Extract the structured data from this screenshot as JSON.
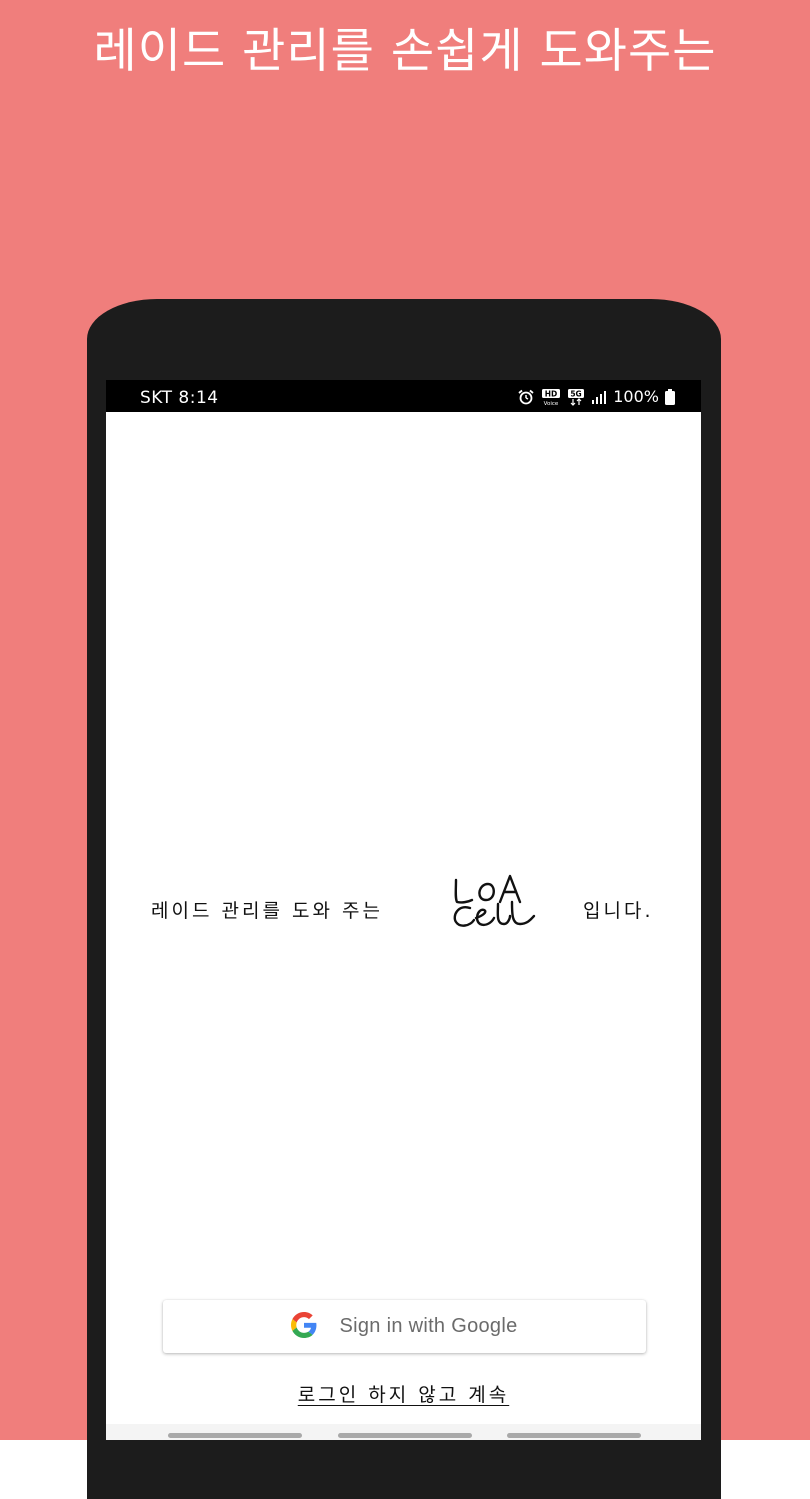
{
  "colors": {
    "background": "#f07e7c",
    "phone_frame": "#1c1c1c",
    "status_bar": "#000000",
    "screen": "#ffffff"
  },
  "headline": "레이드 관리를 손쉽게 도와주는",
  "status_bar": {
    "carrier_time": "SKT 8:14",
    "icons": [
      "alarm-icon",
      "hd-voice-icon",
      "5g-icon",
      "signal-icon",
      "battery-icon"
    ],
    "battery": "100%"
  },
  "tagline": {
    "prefix": "레이드 관리를 도와 주는",
    "logo_text": "LOA CELL",
    "suffix": "입니다."
  },
  "login": {
    "google_label": "Sign in with Google",
    "google_icon": "google-g-icon",
    "skip_label": "로그인 하지 않고 계속"
  }
}
